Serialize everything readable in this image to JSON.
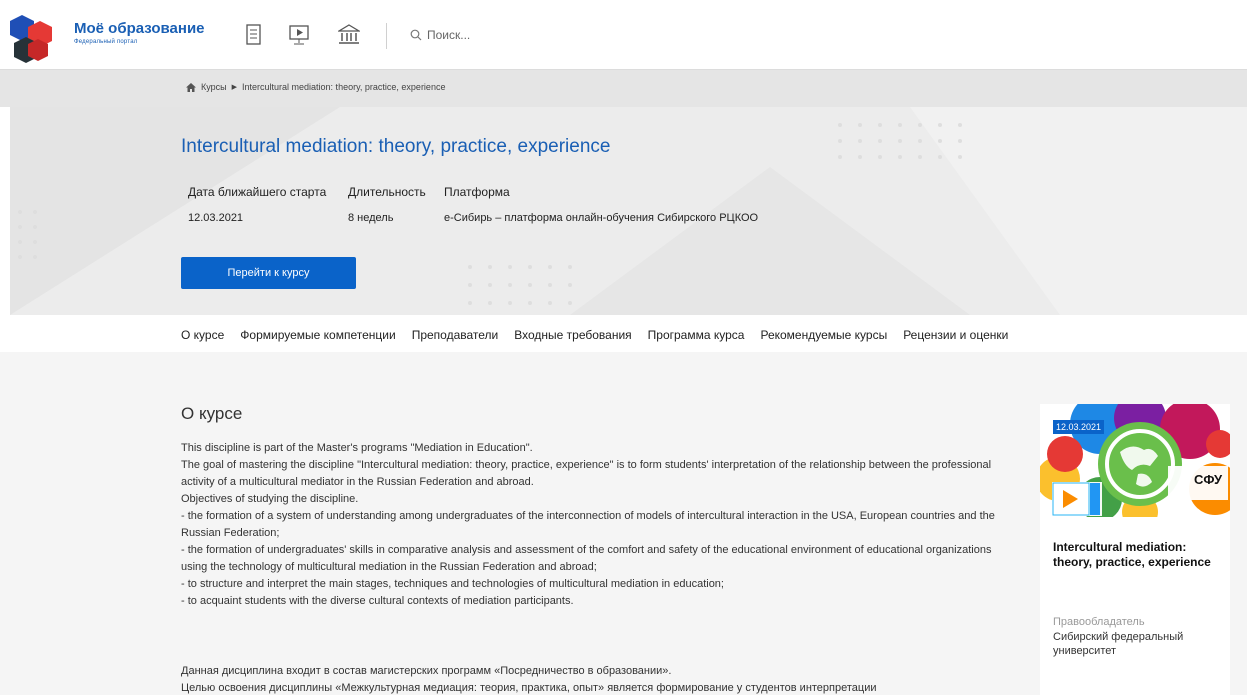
{
  "header": {
    "brand_name": "Моё образование",
    "brand_sub": "Федеральный портал",
    "icons": [
      "documents-icon",
      "video-lesson-icon",
      "museum-icon"
    ],
    "search_placeholder": "Поиск..."
  },
  "breadcrumb": {
    "home_icon": "home-icon",
    "items": [
      "Курсы",
      "Intercultural mediation: theory, practice, experience"
    ]
  },
  "course": {
    "title": "Intercultural mediation: theory, practice, experience",
    "meta_headers": [
      "Дата ближайшего старта",
      "Длительность",
      "Платформа"
    ],
    "start_date": "12.03.2021",
    "duration": "8 недель",
    "platform": "e-Сибирь – платформа онлайн-обучения Сибирского РЦКОО",
    "go_button": "Перейти к курсу"
  },
  "tabs": [
    "О курсе",
    "Формируемые компетенции",
    "Преподаватели",
    "Входные требования",
    "Программа курса",
    "Рекомендуемые курсы",
    "Рецензии и оценки"
  ],
  "about": {
    "title": "О курсе",
    "paragraphs": [
      "This discipline is part of the Master's programs \"Mediation in Education\".",
      "The goal of mastering the discipline \"Intercultural mediation: theory, practice, experience\" is to form students' interpretation of the relationship between the professional activity of a multicultural mediator in the Russian Federation and abroad.",
      "Objectives of studying the discipline.",
      "- the formation of a system of understanding among undergraduates of the interconnection of models of intercultural interaction in the USA, European countries and the Russian Federation;",
      "- the formation of undergraduates' skills in comparative analysis and assessment of the comfort and safety of the educational environment of educational organizations using the technology of multicultural mediation in the Russian Federation and abroad;",
      "- to structure and interpret the main stages, techniques and technologies of multicultural mediation in education;",
      "- to acquaint students with the diverse cultural contexts of mediation participants."
    ],
    "paragraphs_ru": [
      "Данная дисциплина входит в состав магистерских программ «Посредничество в образовании».",
      "Целью освоения дисциплины «Межкультурная медиация: теория, практика, опыт» является формирование у студентов интерпретации"
    ]
  },
  "card": {
    "date": "12.03.2021",
    "logo_text": "СФУ",
    "title": "Intercultural mediation: theory, practice, experience",
    "owner_label": "Правообладатель",
    "owner_value": "Сибирский федеральный университет"
  },
  "colors": {
    "accent": "#0a63c9",
    "title_blue": "#1a5fb4"
  }
}
